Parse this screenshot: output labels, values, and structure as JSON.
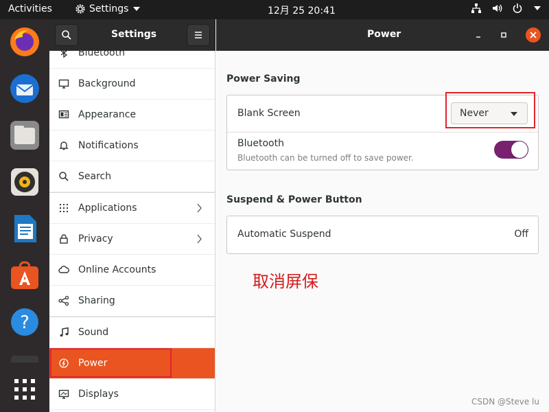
{
  "topbar": {
    "activities": "Activities",
    "app_name": "Settings",
    "clock": "12月 25  20:41",
    "tray_icons": [
      "network-icon",
      "volume-icon",
      "power-icon",
      "chevron-down-icon"
    ]
  },
  "dock": {
    "apps": [
      "firefox-icon",
      "thunderbird-icon",
      "files-icon",
      "rhythmbox-icon",
      "libreoffice-writer-icon",
      "software-icon",
      "help-icon",
      "terminal-icon",
      "show-apps-icon"
    ]
  },
  "sidebar": {
    "title": "Settings",
    "items": [
      {
        "label": "Bluetooth",
        "icon": "bluetooth-icon"
      },
      {
        "label": "Background",
        "icon": "background-icon"
      },
      {
        "label": "Appearance",
        "icon": "appearance-icon"
      },
      {
        "label": "Notifications",
        "icon": "bell-icon"
      },
      {
        "label": "Search",
        "icon": "search-icon"
      },
      {
        "label": "Applications",
        "icon": "grid-icon"
      },
      {
        "label": "Privacy",
        "icon": "lock-icon"
      },
      {
        "label": "Online Accounts",
        "icon": "cloud-icon"
      },
      {
        "label": "Sharing",
        "icon": "share-icon"
      },
      {
        "label": "Sound",
        "icon": "music-note-icon"
      },
      {
        "label": "Power",
        "icon": "power-icon"
      },
      {
        "label": "Displays",
        "icon": "display-icon"
      }
    ],
    "active": "Power"
  },
  "main": {
    "title": "Power",
    "power_saving": {
      "heading": "Power Saving",
      "blank_screen_label": "Blank Screen",
      "blank_screen_value": "Never",
      "bluetooth_label": "Bluetooth",
      "bluetooth_sub": "Bluetooth can be turned off to save power.",
      "bluetooth_on": true
    },
    "suspend": {
      "heading": "Suspend & Power Button",
      "auto_suspend_label": "Automatic Suspend",
      "auto_suspend_value": "Off"
    }
  },
  "annotation": "取消屏保",
  "watermark": "CSDN @Steve lu",
  "colors": {
    "accent": "#e95420",
    "toggle": "#77216f",
    "highlight": "#e0232b"
  }
}
